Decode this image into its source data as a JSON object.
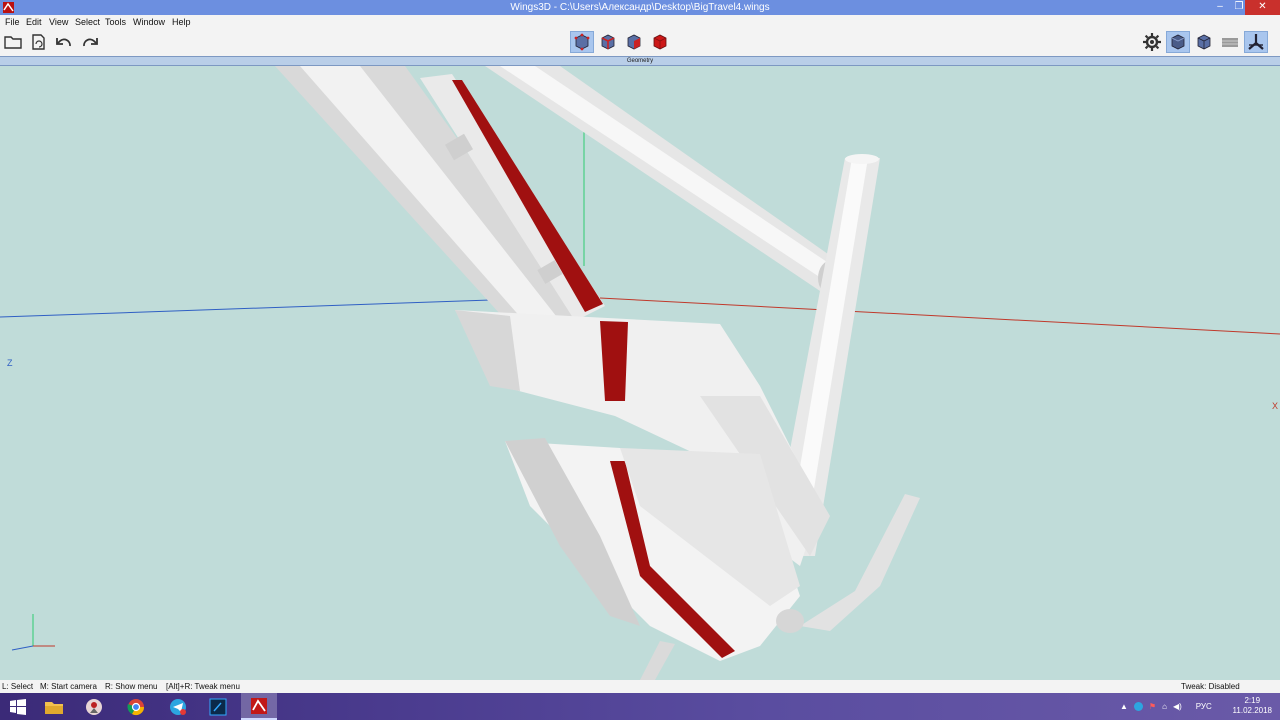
{
  "window": {
    "title": "Wings3D - C:\\Users\\Александр\\Desktop\\BigTravel4.wings",
    "minimize": "–",
    "restore": "❐",
    "close": "✕"
  },
  "menu": [
    "File",
    "Edit",
    "View",
    "Select",
    "Tools",
    "Window",
    "Help"
  ],
  "toolbar": {
    "left": [
      {
        "name": "open-folder-icon"
      },
      {
        "name": "import-icon"
      },
      {
        "name": "undo-icon"
      },
      {
        "name": "redo-icon"
      }
    ],
    "select_modes": [
      {
        "name": "vertex-select-mode",
        "active": true
      },
      {
        "name": "edge-select-mode",
        "active": false
      },
      {
        "name": "face-select-mode",
        "active": false
      },
      {
        "name": "body-select-mode",
        "active": false
      }
    ],
    "right": [
      {
        "name": "preferences-gear-icon",
        "active": false
      },
      {
        "name": "smooth-shading-icon",
        "active": true
      },
      {
        "name": "flat-shading-icon",
        "active": false
      },
      {
        "name": "ground-plane-icon",
        "active": false
      },
      {
        "name": "axes-toggle-icon",
        "active": true
      }
    ]
  },
  "mode_label": "Geometry",
  "viewport": {
    "axis_labels": {
      "z": "Z",
      "x": "X"
    },
    "colors": {
      "background": "#c0dcd9",
      "x_axis": "#c0392b",
      "y_axis": "#2ecc71",
      "z_axis": "#2f5fc4",
      "accent_red": "#a01010"
    }
  },
  "status": {
    "hints": [
      "L: Select",
      "M: Start camera",
      "R: Show menu",
      "[Alt]+R: Tweak menu"
    ],
    "right": "Tweak: Disabled"
  },
  "taskbar": {
    "apps": [
      {
        "name": "start-button"
      },
      {
        "name": "file-explorer-icon"
      },
      {
        "name": "app-icon-2"
      },
      {
        "name": "chrome-icon"
      },
      {
        "name": "telegram-icon"
      },
      {
        "name": "photoshop-icon"
      },
      {
        "name": "wings3d-taskbar-icon",
        "active": true
      }
    ],
    "language": "РУС",
    "time": "2:19",
    "date": "11.02.2018"
  }
}
